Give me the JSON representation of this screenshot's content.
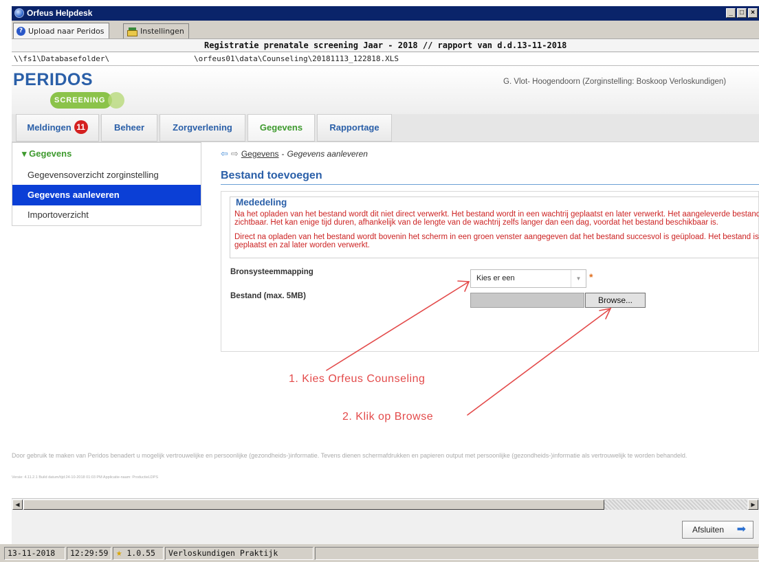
{
  "window": {
    "title": "Orfeus Helpdesk"
  },
  "tabs": [
    {
      "label": "Upload naar Peridos",
      "icon": "help-icon"
    },
    {
      "label": "Instellingen",
      "icon": "settings-icon"
    }
  ],
  "report_title": "Registratie prenatale screening Jaar - 2018 // rapport van d.d.13-11-2018",
  "paths": {
    "database": "\\\\fs1\\Databasefolder\\",
    "file": "\\orfeus01\\data\\Counseling\\20181113_122818.XLS"
  },
  "app": {
    "logo_top": "PERIDOS",
    "logo_sub": "SCREENING",
    "user": "G. Vlot- Hoogendoorn (Zorginstelling: Boskoop Verloskundigen)"
  },
  "nav": {
    "items": [
      {
        "label": "Meldingen",
        "badge": "11"
      },
      {
        "label": "Beheer"
      },
      {
        "label": "Zorgverlening"
      },
      {
        "label": "Gegevens"
      },
      {
        "label": "Rapportage"
      }
    ],
    "active": "Gegevens"
  },
  "sidebar": {
    "header": "Gegevens",
    "items": [
      {
        "label": "Gegevensoverzicht zorginstelling"
      },
      {
        "label": "Gegevens aanleveren"
      },
      {
        "label": "Importoverzicht"
      }
    ]
  },
  "breadcrumb": {
    "link": "Gegevens",
    "separator": "-",
    "current": "Gegevens aanleveren"
  },
  "section_title": "Bestand toevoegen",
  "notice": {
    "title": "Mededeling",
    "lines": [
      "Na het opladen van het bestand wordt dit niet direct verwerkt. Het bestand wordt in een wachtrij geplaatst en later verwerkt. Het aangeleverde bestand is pas",
      "zichtbaar. Het kan enige tijd duren, afhankelijk van de lengte van de wachtrij zelfs langer dan een dag, voordat het bestand beschikbaar is.",
      "Direct na opladen van het bestand wordt bovenin het scherm in een groen venster aangegeven dat het bestand succesvol is geüpload. Het bestand is in de wachtrij",
      "geplaatst en zal later worden verwerkt."
    ]
  },
  "form": {
    "mapping_label": "Bronsysteemmapping",
    "mapping_value": "Kies er een",
    "required_mark": "*",
    "file_label": "Bestand (max. 5MB)",
    "browse_label": "Browse..."
  },
  "annotations": {
    "step1": "1. Kies Orfeus Counseling",
    "step2": "2. Klik op  Browse",
    "color": "#e34a4a"
  },
  "footer": {
    "disclaimer": "Door gebruik te maken van Peridos benadert u mogelijk vertrouwelijke en persoonlijke (gezondheids-)informatie. Tevens dienen schermafdrukken en papieren output met persoonlijke (gezondheids-)informatie als vertrouwelijk te worden behandeld.",
    "version": "Versie: 4.11.2.1 Build datum/tijd:24-10-2018 01:03 PM Applicatie-naam: ProductieLDPS"
  },
  "close_button": "Afsluiten",
  "status": {
    "date": "13-11-2018",
    "time": "12:29:59",
    "version": "1.0.55",
    "practice": "Verloskundigen Praktijk"
  },
  "colors": {
    "titlebar": "#0a246a",
    "brand_blue": "#2a5fa8",
    "brand_green": "#3e9a2e",
    "sidebar_active": "#0b3fd6",
    "notice_red": "#cc2222",
    "badge_red": "#d42020"
  }
}
